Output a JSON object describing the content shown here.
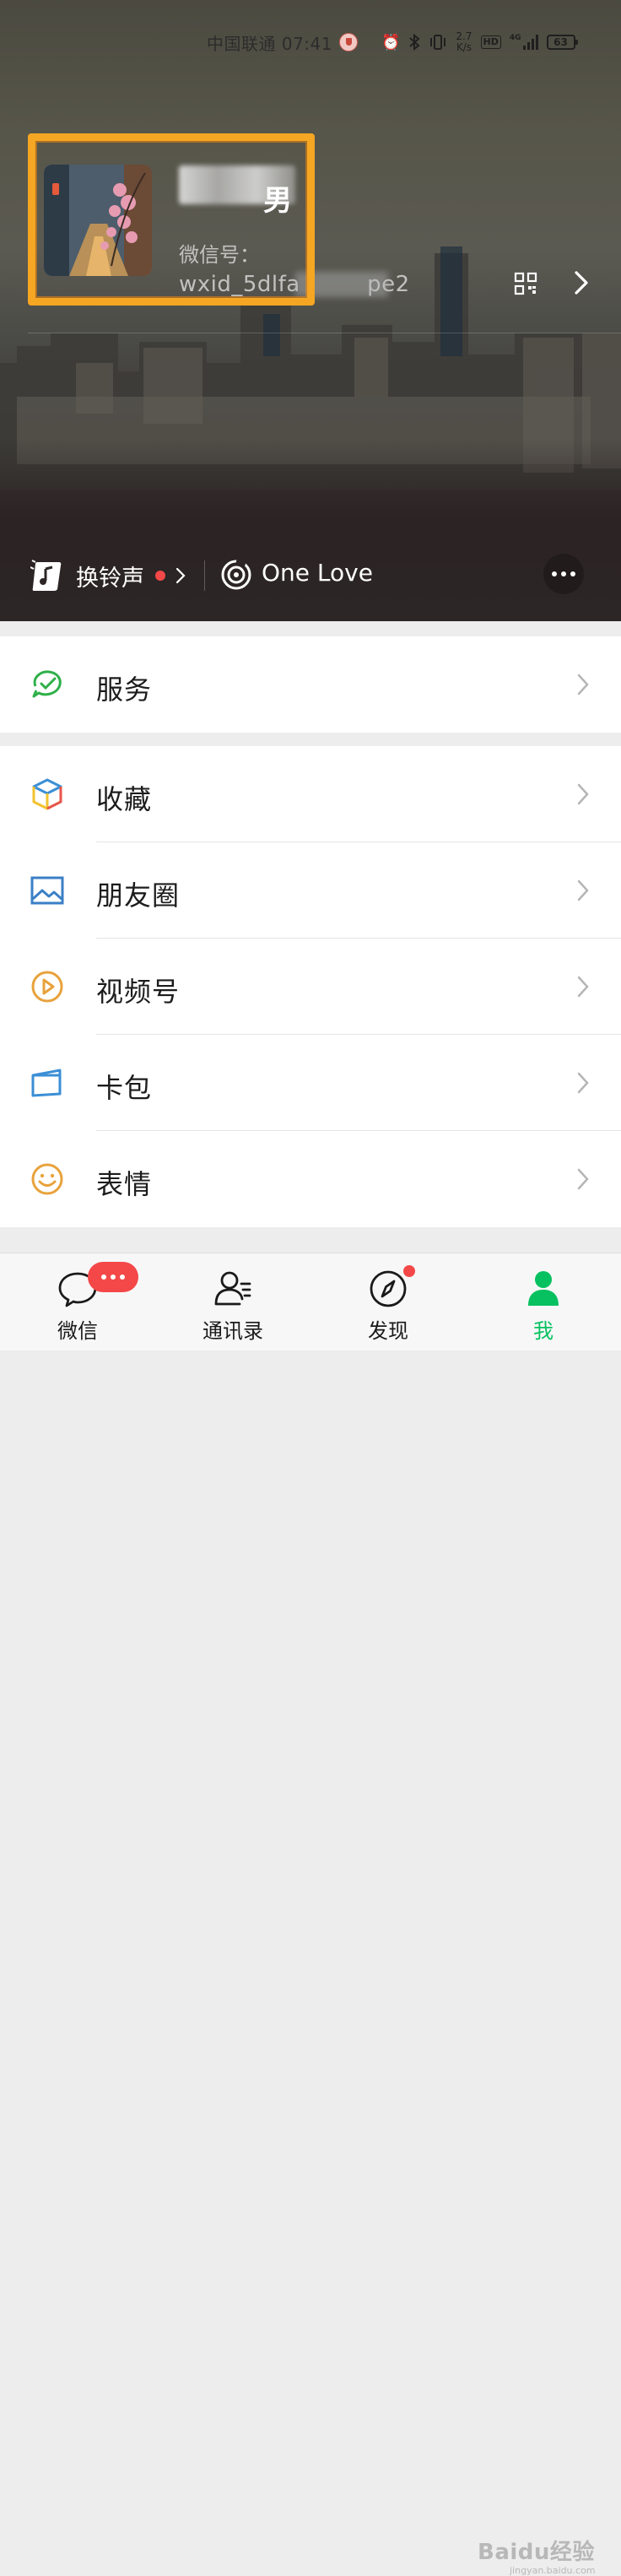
{
  "status_bar": {
    "carrier_time": "中国联通 07:41",
    "net_speed": "2.7\nK/s",
    "hd_label": "HD",
    "network": "4G",
    "battery": "63"
  },
  "profile": {
    "nickname_visible": "男",
    "wechat_id_label": "微信号：",
    "wechat_id": "wxid_5dlfa",
    "wechat_id_tail": "pe2"
  },
  "status_row": {
    "ringtone_label": "换铃声",
    "song_name": "One Love"
  },
  "menu": {
    "group1": [
      {
        "label": "服务",
        "icon": "services-icon",
        "color": "#2fb04a"
      }
    ],
    "group2": [
      {
        "label": "收藏",
        "icon": "favorites-cube-icon"
      },
      {
        "label": "朋友圈",
        "icon": "moments-image-icon",
        "color": "#3b7fc7"
      },
      {
        "label": "视频号",
        "icon": "channels-play-icon",
        "color": "#e8a23b"
      },
      {
        "label": "卡包",
        "icon": "card-wallet-icon",
        "color": "#3b8fd6"
      },
      {
        "label": "表情",
        "icon": "sticker-smile-icon",
        "color": "#e8a23b"
      }
    ]
  },
  "tabs": [
    {
      "label": "微信",
      "icon": "chat-bubble-icon"
    },
    {
      "label": "通讯录",
      "icon": "contacts-icon"
    },
    {
      "label": "发现",
      "icon": "compass-icon"
    },
    {
      "label": "我",
      "icon": "me-person-icon",
      "active": true
    }
  ],
  "watermark": {
    "brand": "Baidu经验",
    "url": "jingyan.baidu.com"
  },
  "colors": {
    "accent": "#07c160",
    "badge": "#f44848",
    "highlight": "#f5a623"
  }
}
